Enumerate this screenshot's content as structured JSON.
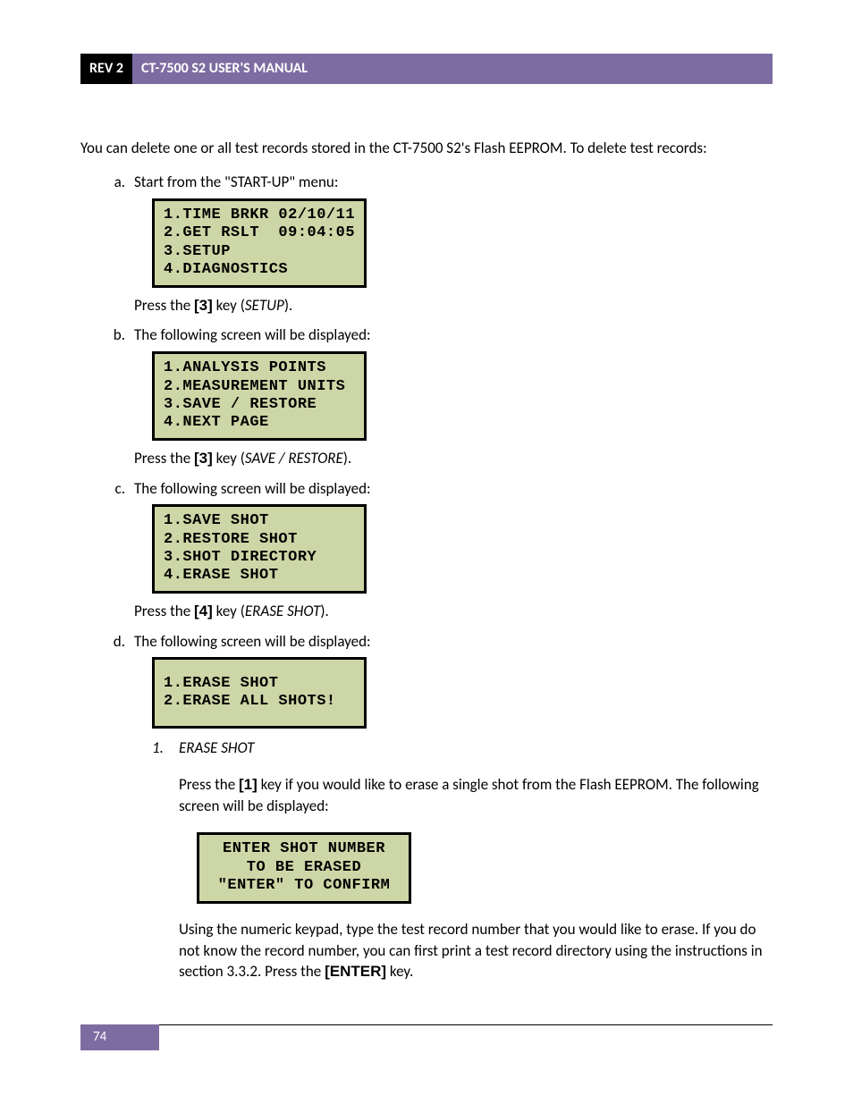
{
  "header": {
    "rev": "REV 2",
    "title": "CT-7500 S2 USER'S MANUAL"
  },
  "intro": "You can delete one or all test records stored in the CT-7500 S2's Flash EEPROM. To delete test records:",
  "steps": {
    "a": {
      "label": "a.",
      "text": "Start from the \"START-UP\" menu:",
      "lcd": [
        "1.TIME BRKR 02/10/11",
        "2.GET RSLT  09:04:05",
        "3.SETUP",
        "4.DIAGNOSTICS"
      ],
      "press_pre": "Press the ",
      "press_key": "[3]",
      "press_mid": " key (",
      "press_opt": "SETUP",
      "press_post": ")."
    },
    "b": {
      "label": "b.",
      "text": "The following screen will be displayed:",
      "lcd": [
        "1.ANALYSIS POINTS",
        "2.MEASUREMENT UNITS",
        "3.SAVE / RESTORE",
        "4.NEXT PAGE"
      ],
      "press_pre": "Press the ",
      "press_key": "[3]",
      "press_mid": " key (",
      "press_opt": "SAVE / RESTORE",
      "press_post": ")."
    },
    "c": {
      "label": "c.",
      "text": "The following screen will be displayed:",
      "lcd": [
        "1.SAVE SHOT",
        "2.RESTORE SHOT",
        "3.SHOT DIRECTORY",
        "4.ERASE SHOT"
      ],
      "press_pre": "Press the ",
      "press_key": "[4]",
      "press_mid": " key (",
      "press_opt": "ERASE SHOT",
      "press_post": ")."
    },
    "d": {
      "label": "d.",
      "text": "The following screen will be displayed:",
      "lcd": [
        "1.ERASE SHOT",
        "2.ERASE ALL SHOTS!",
        "",
        ""
      ],
      "sub": {
        "label": "1.",
        "title": "ERASE SHOT",
        "p1_pre": "Press the ",
        "p1_key": "[1]",
        "p1_post": " key if you would like to erase a single shot from the Flash EEPROM. The following screen will be displayed:",
        "lcd": [
          "ENTER SHOT NUMBER",
          "TO BE ERASED",
          "",
          "\"ENTER\" TO CONFIRM"
        ],
        "p2_pre": "Using the numeric keypad, type the test record number that you would like to erase. If you do not know the record number, you can first print a test record directory using the instructions in section 3.3.2. Press the ",
        "p2_key": "[ENTER]",
        "p2_post": " key."
      }
    }
  },
  "footer": {
    "page": "74"
  }
}
